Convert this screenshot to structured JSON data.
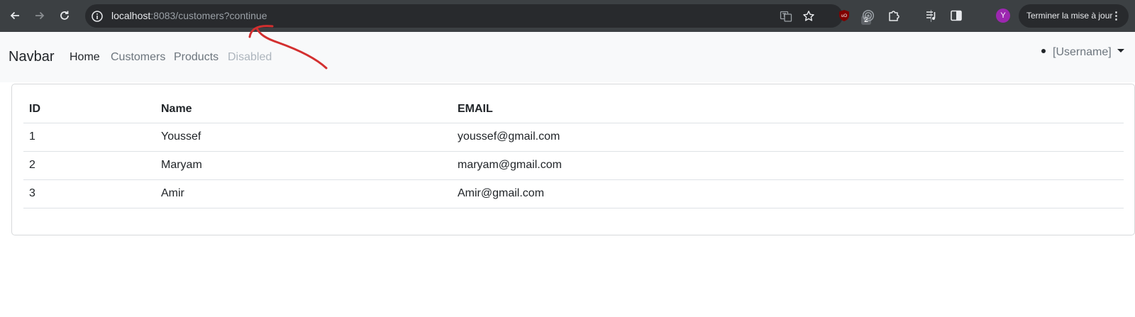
{
  "browser": {
    "url_host": "localhost",
    "url_rest": ":8083/customers?continue",
    "update_label": "Terminer la mise à jour",
    "profile_initial": "Y",
    "ublock_count": "2"
  },
  "navbar": {
    "brand": "Navbar",
    "links": [
      {
        "label": "Home"
      },
      {
        "label": "Customers"
      },
      {
        "label": "Products"
      },
      {
        "label": "Disabled"
      }
    ],
    "user": "[Username]"
  },
  "table": {
    "headers": [
      "ID",
      "Name",
      "EMAIL"
    ],
    "rows": [
      {
        "id": "1",
        "name": "Youssef",
        "email": "youssef@gmail.com"
      },
      {
        "id": "2",
        "name": "Maryam",
        "email": "maryam@gmail.com"
      },
      {
        "id": "3",
        "name": "Amir",
        "email": "Amir@gmail.com"
      }
    ]
  },
  "colors": {
    "chrome_bg": "#3c4043",
    "omnibox_bg": "#282a2d",
    "navbar_bg": "#f8f9fa",
    "annotation": "#d32f2f",
    "avatar": "#9c27b0"
  }
}
